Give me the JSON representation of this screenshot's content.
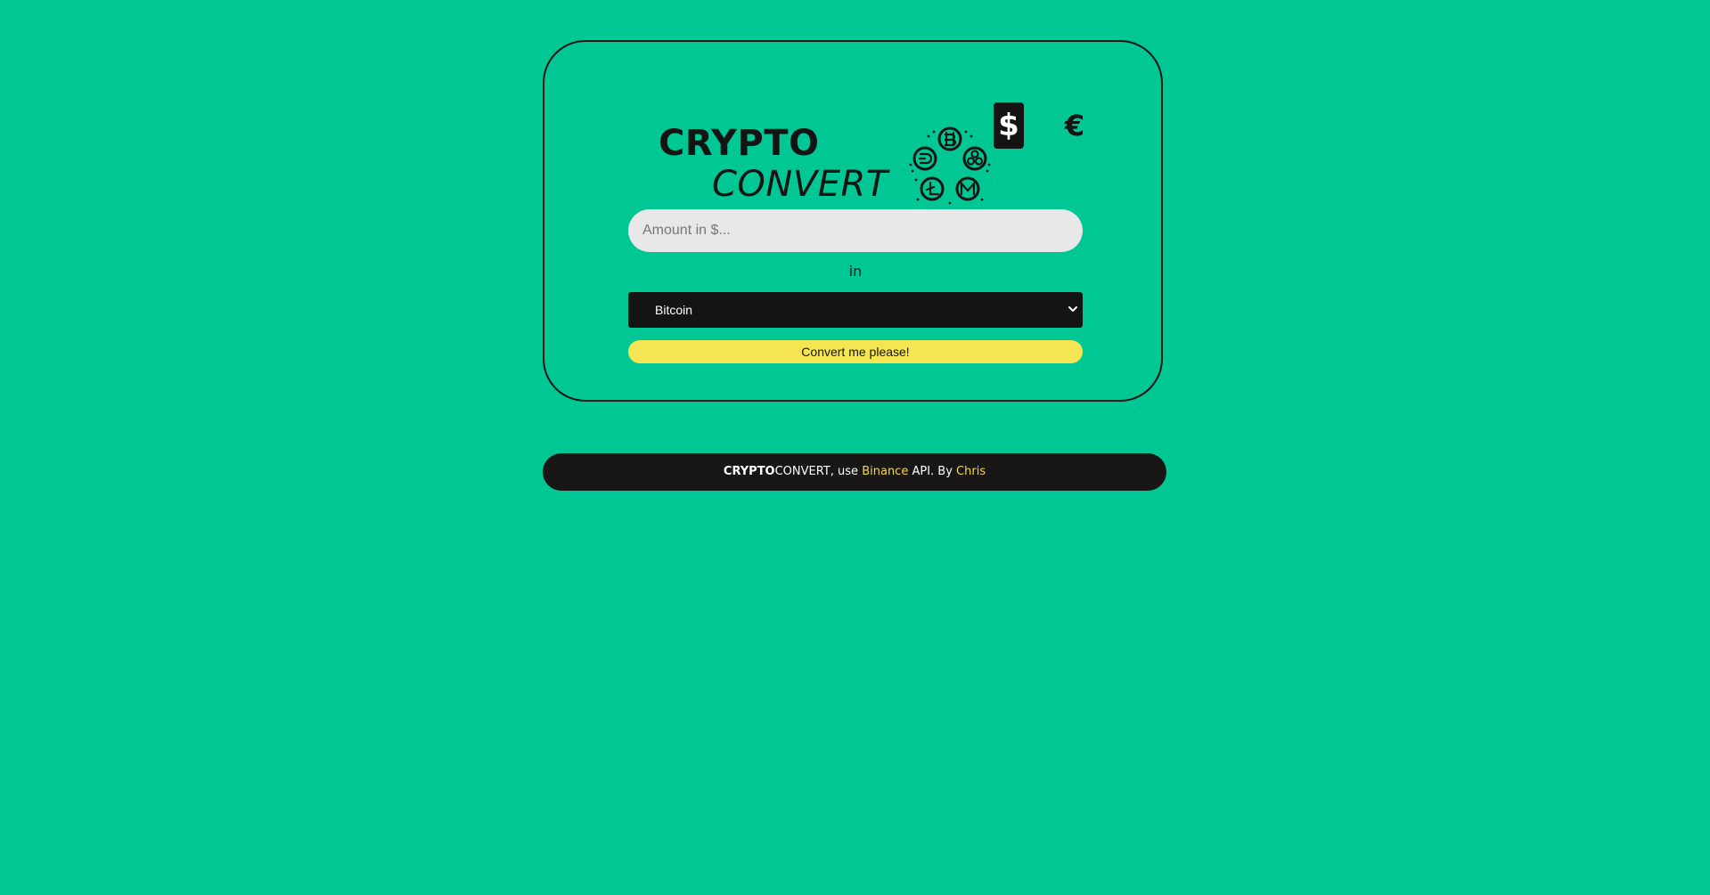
{
  "brand": {
    "word_bold": "CRYPTO",
    "word_italic": "CONVERT"
  },
  "currency": {
    "usd_symbol": "$",
    "eur_symbol": "€",
    "selected": "usd"
  },
  "converter": {
    "amount_placeholder": "Amount in $...",
    "amount_value": "",
    "in_label": "in",
    "selected_crypto": "Bitcoin",
    "convert_button_label": "Convert me please!"
  },
  "footer": {
    "brand_bold": "CRYPTO",
    "brand_rest": "CONVERT",
    "text_use": ", use ",
    "api_link": "Binance",
    "text_api_by": " API. By ",
    "author_link": "Chris"
  },
  "colors": {
    "background": "#00c793",
    "dark": "#141414",
    "accent_yellow": "#f5e552",
    "link_yellow": "#f5d94a",
    "input_bg": "#e8e8e8"
  },
  "icons": {
    "logo_coins": [
      "bitcoin-coin-icon",
      "dash-coin-icon",
      "ripple-coin-icon",
      "litecoin-coin-icon",
      "monero-coin-icon"
    ],
    "select_chevron": "chevron-down-icon"
  }
}
